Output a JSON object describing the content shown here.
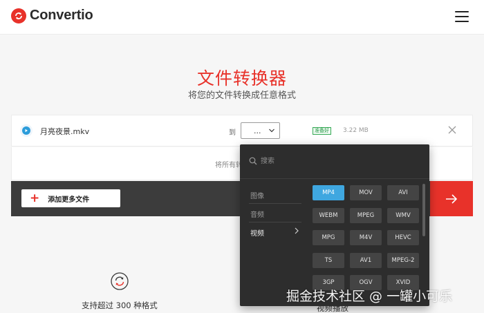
{
  "brand": {
    "name": "Convertio",
    "accent": "#e8322a"
  },
  "hero": {
    "title": "文件转换器",
    "subtitle": "将您的文件转换成任意格式"
  },
  "file": {
    "name": "月亮夜景.mkv",
    "to_label": "到",
    "format_value": "...",
    "status": "准备好",
    "size": "3.22 MB"
  },
  "notice": {
    "text": "将所有转"
  },
  "actions": {
    "add_files": "添加更多文件"
  },
  "panel": {
    "search_placeholder": "搜索",
    "categories": [
      {
        "label": "图像",
        "active": false
      },
      {
        "label": "音频",
        "active": false
      },
      {
        "label": "视频",
        "active": true
      }
    ],
    "formats": [
      "MP4",
      "MOV",
      "AVI",
      "WEBM",
      "MPEG",
      "WMV",
      "MPG",
      "M4V",
      "HEVC",
      "TS",
      "AV1",
      "MPEG-2",
      "3GP",
      "OGV",
      "XVID"
    ],
    "selected_format": "MP4",
    "selected_color": "#3fa7e0"
  },
  "features": [
    {
      "text": "支持超过 300 种格式",
      "icon": "refresh-icon"
    },
    {
      "text": "视频播放"
    }
  ],
  "watermark": "掘金技术社区 @ 一罐小可乐"
}
